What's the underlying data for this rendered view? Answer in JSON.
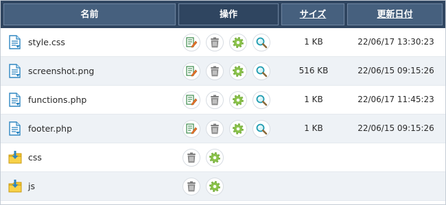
{
  "header": {
    "name": "名前",
    "actions": "操作",
    "size": "サイズ",
    "date": "更新日付"
  },
  "rows": [
    {
      "name": "style.css",
      "type": "file",
      "size": "1 KB",
      "date": "22/06/17 13:30:23"
    },
    {
      "name": "screenshot.png",
      "type": "file",
      "size": "516 KB",
      "date": "22/06/15 09:15:26"
    },
    {
      "name": "functions.php",
      "type": "file",
      "size": "1 KB",
      "date": "22/06/17 11:45:23"
    },
    {
      "name": "footer.php",
      "type": "file",
      "size": "1 KB",
      "date": "22/06/15 09:15:26"
    },
    {
      "name": "css",
      "type": "folder"
    },
    {
      "name": "js",
      "type": "folder"
    }
  ],
  "icons": {
    "file": "file-download-icon",
    "folder": "folder-download-icon",
    "edit": "edit-pencil-icon",
    "delete": "trash-icon",
    "settings": "gear-icon",
    "view": "magnifier-icon"
  },
  "colors": {
    "header_bg": "#2f4560",
    "header_cell": "#46607e",
    "row_alt": "#eef2f6",
    "accent_green": "#7cb342",
    "folder_yellow": "#f4c430",
    "file_blue": "#2e86c1"
  }
}
